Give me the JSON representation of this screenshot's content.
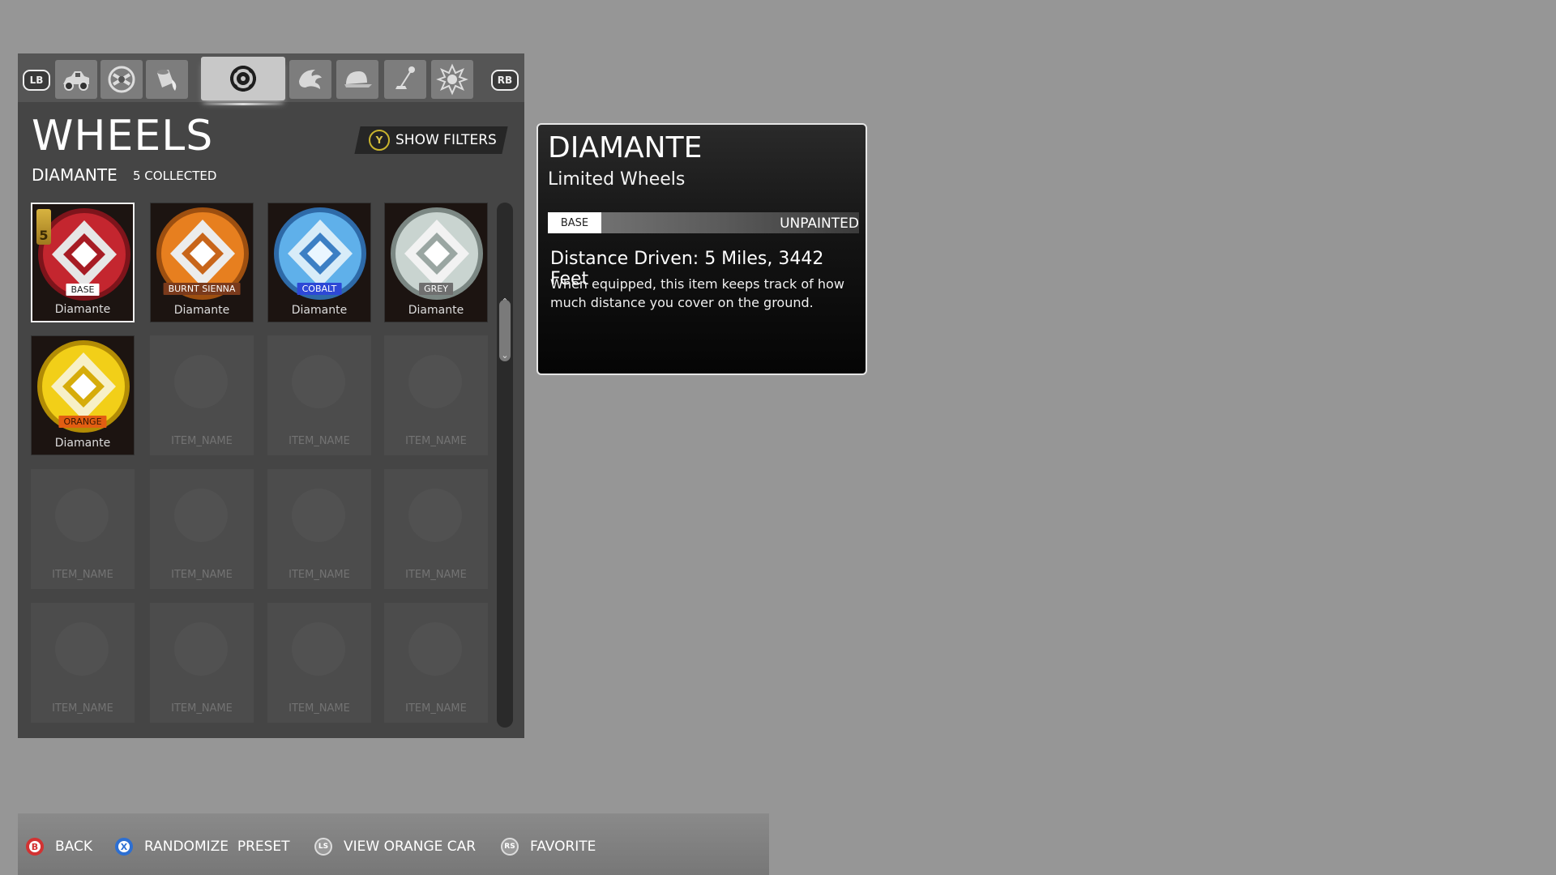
{
  "tabs": {
    "lb": "LB",
    "rb": "RB",
    "items": [
      {
        "icon": "car-body-icon"
      },
      {
        "icon": "decal-icon"
      },
      {
        "icon": "paint-finish-icon"
      },
      {
        "icon": "wheels-icon",
        "active": true
      },
      {
        "icon": "rocket-boost-icon"
      },
      {
        "icon": "topper-icon"
      },
      {
        "icon": "antenna-icon"
      },
      {
        "icon": "goal-explosion-icon"
      }
    ]
  },
  "header": {
    "title": "WHEELS",
    "subtitle": "DIAMANTE",
    "collected": "5 COLLECTED",
    "filter_button_glyph": "Y",
    "filter_label": "SHOW FILTERS"
  },
  "grid": {
    "items": [
      {
        "paint": "BASE",
        "name": "Diamante",
        "favorite_count": "5",
        "colors": {
          "primary": "#c4262f",
          "label_bg": "#ffffff",
          "label_fg": "#222222"
        }
      },
      {
        "paint": "BURNT SIENNA",
        "name": "Diamante",
        "colors": {
          "primary": "#e77f1f",
          "label_bg": "#7a3a1c",
          "label_fg": "#ffffff"
        }
      },
      {
        "paint": "COBALT",
        "name": "Diamante",
        "colors": {
          "primary": "#5fb0ea",
          "label_bg": "#2d48d6",
          "label_fg": "#ffffff"
        }
      },
      {
        "paint": "GREY",
        "name": "Diamante",
        "colors": {
          "primary": "#c9d4d0",
          "label_bg": "#6f6f6f",
          "label_fg": "#ffffff"
        }
      },
      {
        "paint": "ORANGE",
        "name": "Diamante",
        "colors": {
          "primary": "#f2cf18",
          "label_bg": "#e25d12",
          "label_fg": "#3a1600"
        }
      }
    ],
    "empty_label": "ITEM_NAME"
  },
  "detail": {
    "name": "DIAMANTE",
    "category": "Limited Wheels",
    "paint_label": "BASE",
    "paint_value": "UNPAINTED",
    "stat_title": "Distance Driven: 5 Miles, 3442 Feet",
    "stat_description": "When equipped, this item keeps track of how much distance you cover on the ground."
  },
  "prompts": {
    "back": {
      "glyph": "B",
      "label": "BACK"
    },
    "randomize": {
      "glyph": "X",
      "label": "RANDOMIZE  PRESET"
    },
    "view_car": {
      "glyph": "LS",
      "label": "VIEW ORANGE CAR"
    },
    "favorite": {
      "glyph": "RS",
      "label": "FAVORITE"
    }
  }
}
